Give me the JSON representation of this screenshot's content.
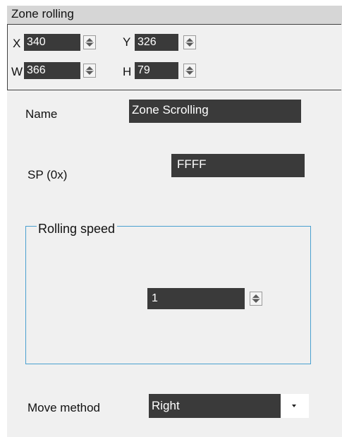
{
  "window": {
    "title": "Zone rolling"
  },
  "geometry": {
    "x": {
      "label": "X",
      "value": "340"
    },
    "y": {
      "label": "Y",
      "value": "326"
    },
    "w": {
      "label": "W",
      "value": "366"
    },
    "h": {
      "label": "H",
      "value": "79"
    }
  },
  "fields": {
    "name": {
      "label": "Name",
      "value": "Zone Scrolling"
    },
    "sp": {
      "label": "SP (0x)",
      "value": "FFFF"
    }
  },
  "rolling_speed": {
    "legend": "Rolling speed",
    "value": "1"
  },
  "move_method": {
    "label": "Move method",
    "value": "Right",
    "icon": "chevron-down-icon"
  },
  "icons": {
    "spinner": "spinner-icon"
  },
  "colors": {
    "field_bg": "#3a3a3a",
    "field_text": "#ffffff",
    "group_border": "#4aa0d0",
    "panel_bg": "#f0f0f0",
    "header_bg": "#d6d6d6"
  }
}
